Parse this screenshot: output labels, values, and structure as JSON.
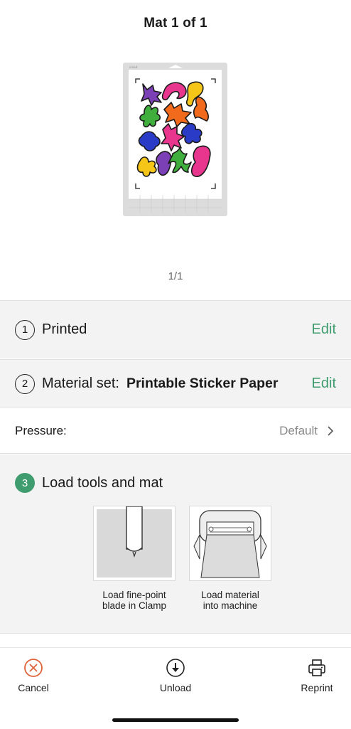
{
  "header": {
    "title": "Mat 1 of 1"
  },
  "mat": {
    "brand": "cricut"
  },
  "pager": {
    "text": "1/1"
  },
  "steps": {
    "printed": {
      "number": "1",
      "label": "Printed",
      "edit": "Edit"
    },
    "material": {
      "number": "2",
      "label": "Material set:",
      "value": "Printable Sticker Paper",
      "edit": "Edit"
    },
    "pressure": {
      "label": "Pressure:",
      "value": "Default"
    },
    "load": {
      "number": "3",
      "label": "Load tools and mat",
      "tools": [
        {
          "caption_line1": "Load fine-point",
          "caption_line2": "blade in Clamp"
        },
        {
          "caption_line1": "Load material",
          "caption_line2": "into machine"
        }
      ]
    }
  },
  "footer": {
    "cancel": "Cancel",
    "unload": "Unload",
    "reprint": "Reprint"
  },
  "colors": {
    "accent": "#3f9c6e",
    "cancel": "#e0623b"
  }
}
